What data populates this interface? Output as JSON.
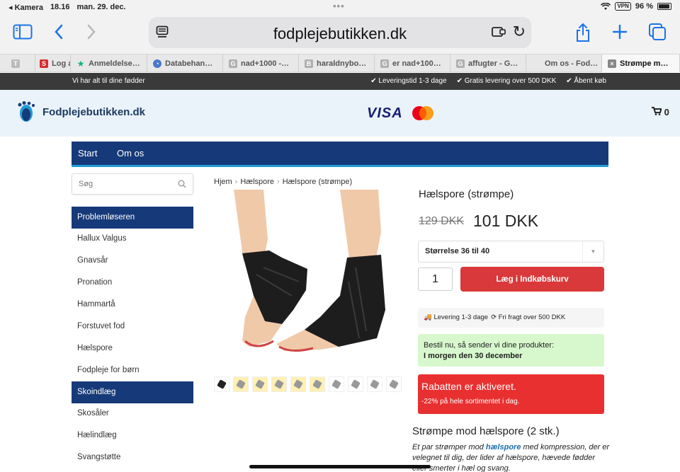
{
  "status": {
    "back_app": "◂ Kamera",
    "time": "18.16",
    "date": "man. 29. dec.",
    "vpn": "VPN",
    "battery": "96 %"
  },
  "browser": {
    "url": "fodplejebutikken.dk"
  },
  "tabs": [
    {
      "label": "",
      "fav": "T",
      "color": "#bbbbbb"
    },
    {
      "label": "Log a",
      "fav": "S",
      "color": "#d92c2c"
    },
    {
      "label": "Anmeldelse…",
      "fav": "★",
      "color": "#00b67a"
    },
    {
      "label": "Databehan…",
      "fav": "◔",
      "color": "#4a78c9"
    },
    {
      "label": "nad+1000 -…",
      "fav": "G",
      "color": "#b0b0b0"
    },
    {
      "label": "haraldnybo…",
      "fav": "B",
      "color": "#b0b0b0"
    },
    {
      "label": "er nad+100…",
      "fav": "G",
      "color": "#b0b0b0"
    },
    {
      "label": "affugter - G…",
      "fav": "G",
      "color": "#b0b0b0"
    },
    {
      "label": "Om os - Fod…",
      "fav": "",
      "color": "#e8e8e8"
    },
    {
      "label": "Strømpe m…",
      "fav": "×",
      "color": "#888888"
    }
  ],
  "shopbar": {
    "slogan": "Vi har alt til dine fødder",
    "usps": [
      "✔ Leveringstid 1-3 dage",
      "✔ Gratis levering over 500 DKK",
      "✔ Åbent køb"
    ]
  },
  "header": {
    "logo": "Fodplejebutikken.dk",
    "visa": "VISA",
    "cart_count": "0"
  },
  "nav": [
    "Start",
    "Om os"
  ],
  "search": {
    "placeholder": "Søg"
  },
  "categories": [
    "Problemløseren",
    "Hallux Valgus",
    "Gnavsår",
    "Pronation",
    "Hammartå",
    "Forstuvet fod",
    "Hælspore",
    "Fodpleje for børn",
    "Skoindlæg",
    "Skosåler",
    "Hælindlæg",
    "Svangstøtte"
  ],
  "breadcrumb": [
    "Hjem",
    "Hælspore",
    "Hælspore (strømpe)"
  ],
  "product": {
    "title": "Hælspore (strømpe)",
    "old_price": "129 DKK",
    "price": "101 DKK",
    "size": "Størrelse 36 til 40",
    "qty": "1",
    "add_to_cart": "Læg i Indkøbskurv",
    "delivery": [
      "🚚 Levering 1-3 dage",
      "⟳ Fri fragt over 500 DKK"
    ],
    "order_now": "Bestil nu, så sender vi dine produkter:",
    "ship_date": "I morgen den 30 december",
    "discount_title": "Rabatten er aktiveret.",
    "discount_text": "-22% på hele sortimentet i dag.",
    "desc_title": "Strømpe mod hælspore (2 stk.)",
    "desc_pre": "Et par strømper mod ",
    "desc_link": "hælspore",
    "desc_post": " med kompression, der er velegnet til dig, der lider af hælspore, hævede fødder eller smerter i hæl og svang."
  }
}
